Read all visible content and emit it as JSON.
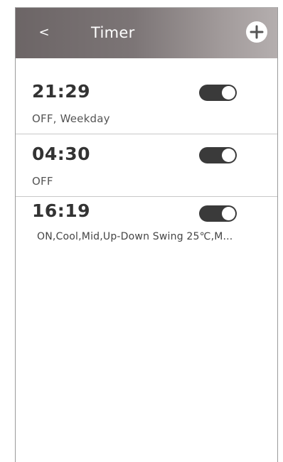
{
  "header": {
    "back_label": "<",
    "title": "Timer",
    "add_label": "+"
  },
  "timers": [
    {
      "time": "21:29",
      "description": "OFF, Weekday",
      "enabled": true
    },
    {
      "time": "04:30",
      "description": "OFF",
      "enabled": true
    },
    {
      "time": "16:19",
      "description": "ON,Cool,Mid,Up-Down Swing 25℃,M...",
      "enabled": true
    }
  ],
  "colors": {
    "header_dark": "#6c6566",
    "header_light": "#b4aeae",
    "toggle_on": "#3a3a3a",
    "text_primary": "#333333"
  },
  "icons": {
    "back": "chevron-left-icon",
    "add": "plus-icon"
  }
}
